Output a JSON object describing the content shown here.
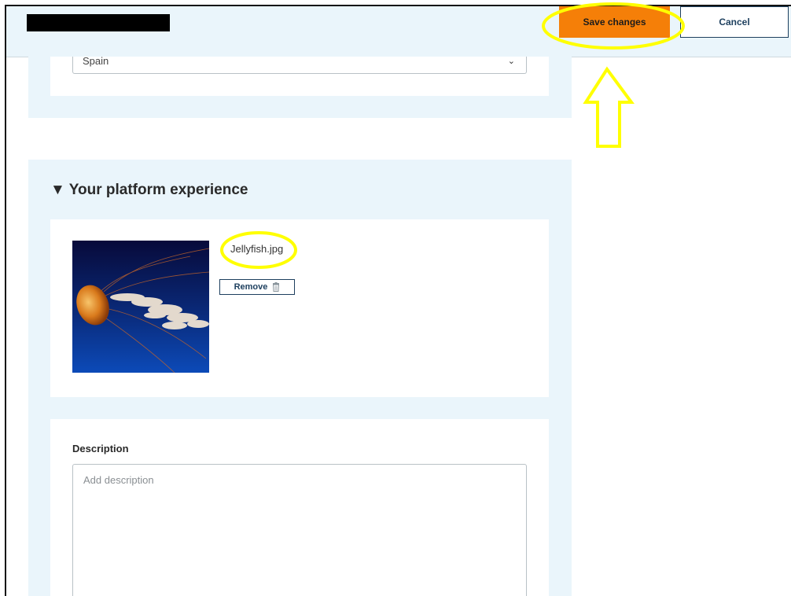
{
  "header": {
    "save_label": "Save changes",
    "cancel_label": "Cancel"
  },
  "location": {
    "selected_country": "Spain"
  },
  "experience": {
    "heading": "▼ Your platform experience",
    "file_name": "Jellyfish.jpg",
    "remove_label": "Remove",
    "remove_icon": "trash-icon"
  },
  "description": {
    "label": "Description",
    "placeholder": "Add description",
    "value": ""
  },
  "colors": {
    "accent": "#f57f08",
    "panel_bg": "#eaf5fb",
    "navy": "#1d3f5e",
    "annotation": "#ffff00"
  }
}
